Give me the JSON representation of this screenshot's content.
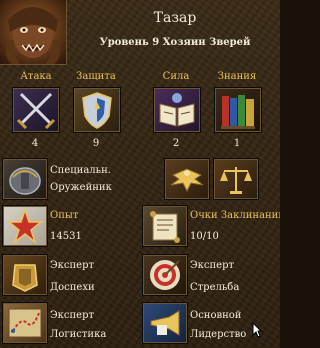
{
  "hero": {
    "name": "Тазар",
    "subtitle": "Уровень 9 Хозяин Зверей"
  },
  "primary_skills": [
    {
      "label": "Атака",
      "value": "4",
      "icon": "crossed-swords-icon"
    },
    {
      "label": "Защита",
      "value": "9",
      "icon": "shield-icon"
    },
    {
      "label": "Сила",
      "value": "2",
      "icon": "spellbook-icon"
    },
    {
      "label": "Знания",
      "value": "1",
      "icon": "books-icon"
    }
  ],
  "specialty": {
    "title": "Специальн.",
    "value": "Оружейник"
  },
  "morale_icon": "morale-eagle-icon",
  "luck_icon": "luck-scales-icon",
  "experience": {
    "label": "Опыт",
    "value": "14531"
  },
  "spell_points": {
    "label": "Очки Заклинаний",
    "value": "10/10"
  },
  "secondary_skills": [
    {
      "level": "Эксперт",
      "name": "Доспехи",
      "icon": "armorer-icon"
    },
    {
      "level": "Эксперт",
      "name": "Стрельба",
      "icon": "archery-target-icon"
    },
    {
      "level": "Эксперт",
      "name": "Логистика",
      "icon": "logistics-map-icon"
    },
    {
      "level": "Основной",
      "name": "Лидерство",
      "icon": "leadership-trumpet-icon"
    }
  ],
  "colors": {
    "label_gold": "#e8c45a",
    "text_white": "#f2ecdc",
    "background": "#2c1f10"
  }
}
